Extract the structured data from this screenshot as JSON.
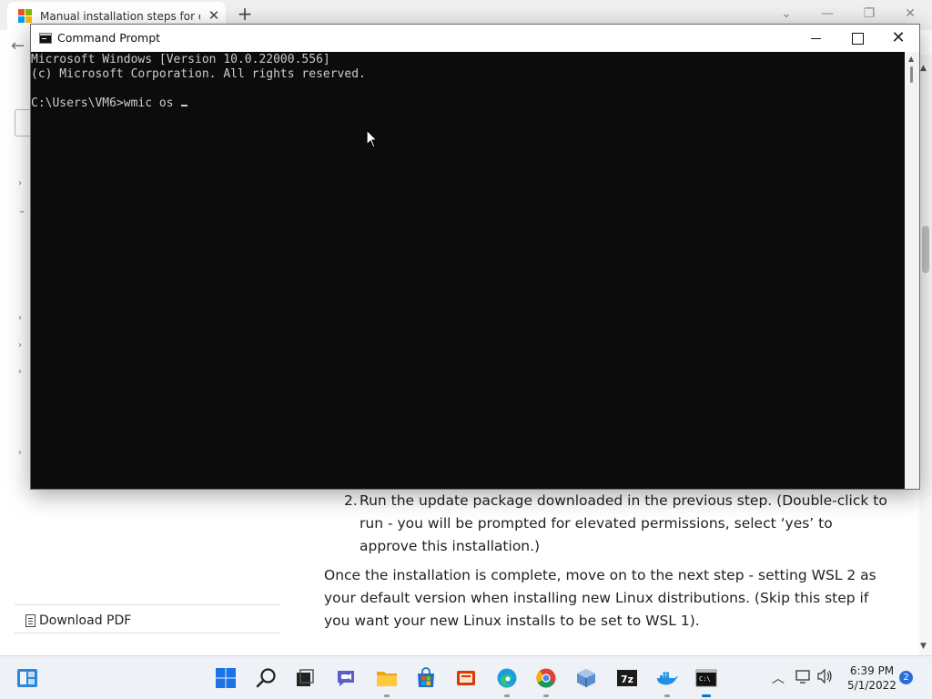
{
  "browser": {
    "tab_title": "Manual installation steps for older",
    "sidebar": {
      "download_pdf": "Download PDF"
    },
    "article": {
      "step_number": "2.",
      "step_text": "Run the update package downloaded in the previous step. (Double-click to run - you will be prompted for elevated permissions, select ‘yes’ to approve this installation.)",
      "paragraph": "Once the installation is complete, move on to the next step - setting WSL 2 as your default version when installing new Linux distributions. (Skip this step if you want your new Linux installs to be set to WSL 1)."
    }
  },
  "cmd": {
    "title": "Command Prompt",
    "lines": [
      "Microsoft Windows [Version 10.0.22000.556]",
      "(c) Microsoft Corporation. All rights reserved.",
      "",
      "C:\\Users\\VM6>wmic os "
    ]
  },
  "taskbar": {
    "apps": [
      "start",
      "search",
      "task-view",
      "chat",
      "file-explorer",
      "store",
      "office",
      "edge",
      "chrome",
      "virtualbox",
      "7zip",
      "docker",
      "command-prompt"
    ],
    "clock_time": "6:39 PM",
    "clock_date": "5/1/2022",
    "notification_count": "2"
  },
  "colors": {
    "console_bg": "#0c0c0c",
    "console_fg": "#cccccc",
    "accent": "#0078d4",
    "taskbar_bg": "#eef1f6"
  }
}
